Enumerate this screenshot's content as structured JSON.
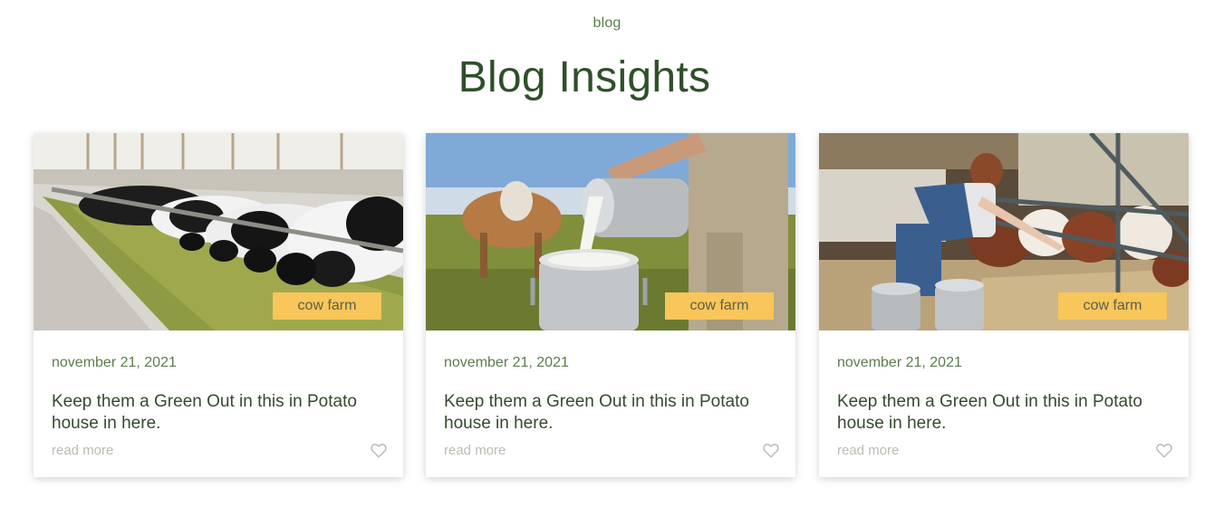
{
  "section": {
    "eyebrow": "blog",
    "title": "Blog Insights"
  },
  "posts": [
    {
      "image": "cows-feeding-in-barn-photo",
      "tag": "cow farm",
      "date": "november 21, 2021",
      "title": "Keep them a Green Out in this in Potato house in here.",
      "read_more": "read more",
      "like_icon": "heart-outline-icon"
    },
    {
      "image": "milk-pouring-into-can-photo",
      "tag": "cow farm",
      "date": "november 21, 2021",
      "title": "Keep them a Green Out in this in Potato house in here.",
      "read_more": "read more",
      "like_icon": "heart-outline-icon"
    },
    {
      "image": "woman-feeding-calves-photo",
      "tag": "cow farm",
      "date": "november 21, 2021",
      "title": "Keep them a Green Out in this in Potato house in here.",
      "read_more": "read more",
      "like_icon": "heart-outline-icon"
    }
  ],
  "colors": {
    "accent_green": "#2f4f2a",
    "tag_yellow": "#f8c65a",
    "muted_text": "#b8bdb3"
  }
}
